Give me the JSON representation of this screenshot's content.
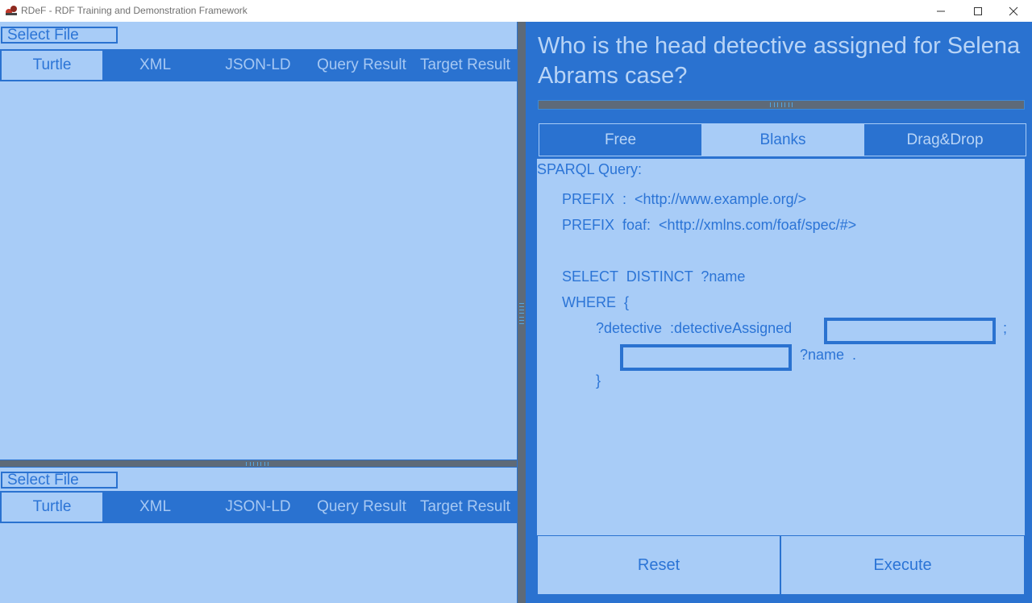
{
  "window": {
    "title": "RDeF - RDF Training and Demonstration Framework",
    "app_icon": "rdef-logo-icon",
    "controls": [
      "minimize-icon",
      "maximize-icon",
      "close-icon"
    ]
  },
  "left_top": {
    "select_file": "Select File",
    "tabs": [
      {
        "label": "Turtle",
        "active": true
      },
      {
        "label": "XML",
        "active": false
      },
      {
        "label": "JSON-LD",
        "active": false
      },
      {
        "label": "Query Result",
        "active": false
      },
      {
        "label": "Target Result",
        "active": false
      }
    ]
  },
  "left_bottom": {
    "select_file": "Select File",
    "tabs": [
      {
        "label": "Turtle",
        "active": true
      },
      {
        "label": "XML",
        "active": false
      },
      {
        "label": "JSON-LD",
        "active": false
      },
      {
        "label": "Query Result",
        "active": false
      },
      {
        "label": "Target Result",
        "active": false
      }
    ]
  },
  "right": {
    "question": "Who is the head detective assigned for Selena Abrams case?",
    "modes": [
      {
        "label": "Free",
        "active": false
      },
      {
        "label": "Blanks",
        "active": true
      },
      {
        "label": "Drag&Drop",
        "active": false
      }
    ],
    "query": {
      "label": "SPARQL Query:",
      "prefix1": "PREFIX  :  <http://www.example.org/>",
      "prefix2": "PREFIX  foaf:  <http://xmlns.com/foaf/spec/#>",
      "select": "SELECT  DISTINCT  ?name",
      "where": "WHERE  {",
      "triple_subject": "?detective  :detectiveAssigned",
      "semicolon": ";",
      "object_name": "?name  .",
      "close_brace": "}",
      "blank1_value": "",
      "blank2_value": ""
    },
    "buttons": {
      "reset": "Reset",
      "execute": "Execute"
    }
  },
  "colors": {
    "primary": "#2a72d0",
    "light": "#a8ccf7",
    "splitter": "#5e6a78"
  }
}
